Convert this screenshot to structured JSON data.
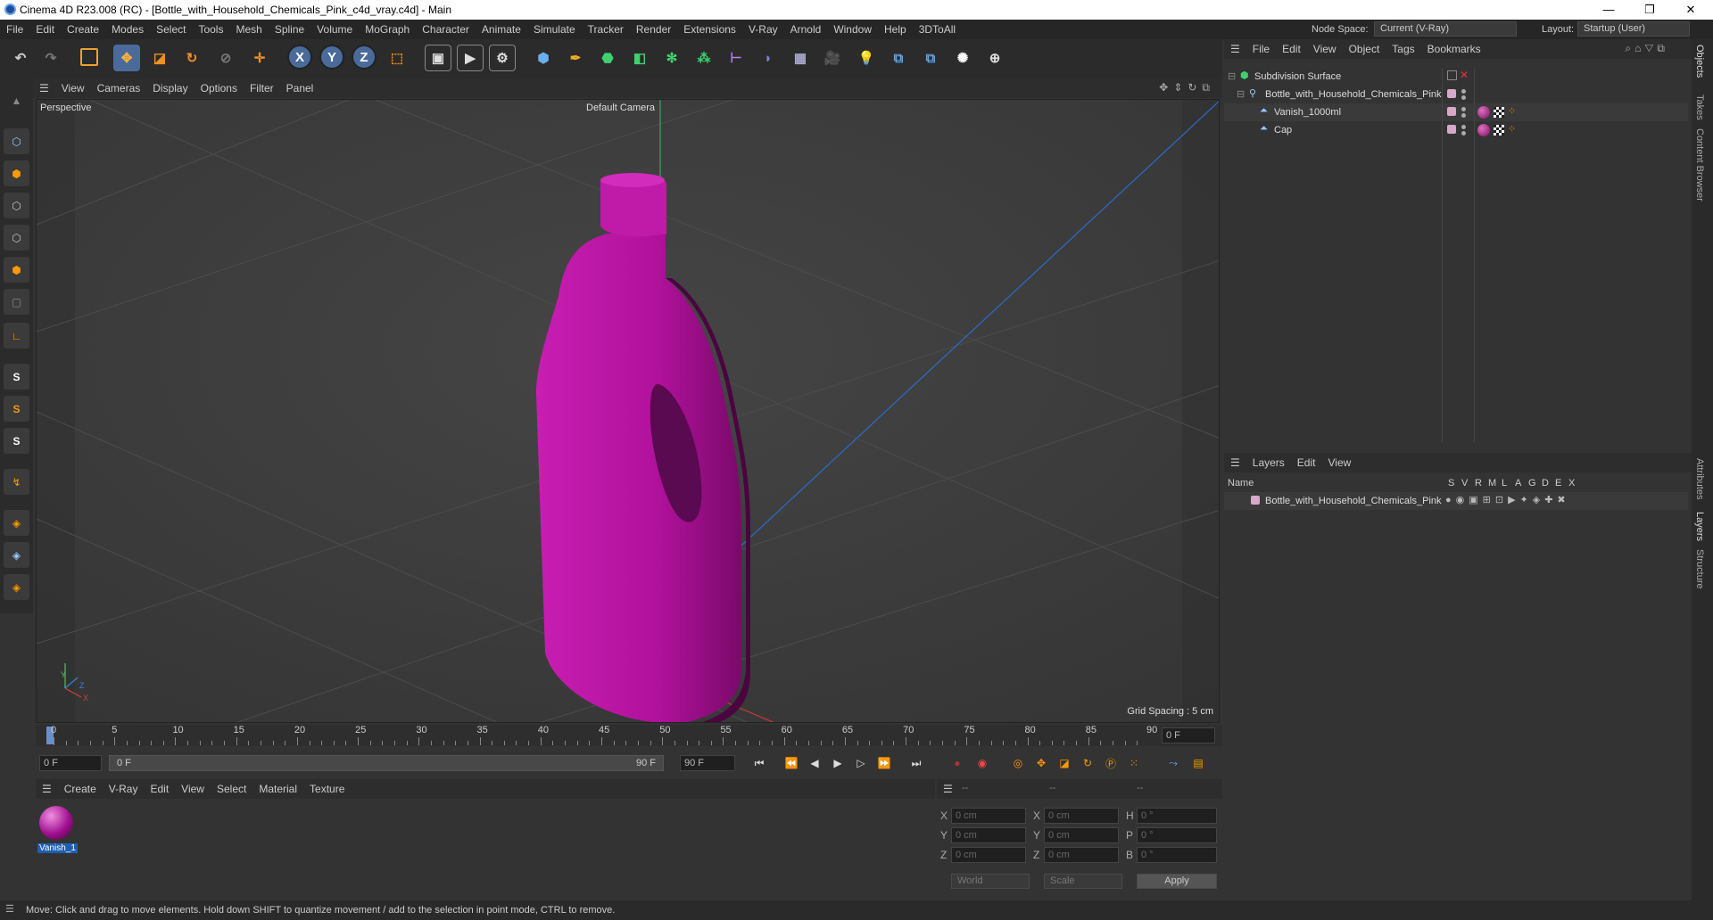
{
  "window": {
    "title": "Cinema 4D R23.008 (RC) - [Bottle_with_Household_Chemicals_Pink_c4d_vray.c4d] - Main",
    "minimize": "—",
    "maximize": "❐",
    "close": "✕"
  },
  "menu": [
    "File",
    "Edit",
    "Create",
    "Modes",
    "Select",
    "Tools",
    "Mesh",
    "Spline",
    "Volume",
    "MoGraph",
    "Character",
    "Animate",
    "Simulate",
    "Tracker",
    "Render",
    "Extensions",
    "V-Ray",
    "Arnold",
    "Window",
    "Help",
    "3DToAll"
  ],
  "nodespace": {
    "label": "Node Space:",
    "value": "Current (V-Ray)"
  },
  "layout": {
    "label": "Layout:",
    "value": "Startup (User)"
  },
  "viewport": {
    "menu": [
      "View",
      "Cameras",
      "Display",
      "Options",
      "Filter",
      "Panel"
    ],
    "label": "Perspective",
    "camera": "Default Camera",
    "grid_spacing": "Grid Spacing : 5 cm",
    "axis_y": "Y",
    "axis_z": "Z",
    "axis_x": "X"
  },
  "timeline": {
    "ticks": [
      "0",
      "5",
      "10",
      "15",
      "20",
      "25",
      "30",
      "35",
      "40",
      "45",
      "50",
      "55",
      "60",
      "65",
      "70",
      "75",
      "80",
      "85",
      "90"
    ],
    "current": "0 F"
  },
  "transport": {
    "start": "0 F",
    "range_start": "0 F",
    "range_end": "90 F",
    "end": "90 F"
  },
  "materials": {
    "menu": [
      "Create",
      "V-Ray",
      "Edit",
      "View",
      "Select",
      "Material",
      "Texture"
    ],
    "items": [
      {
        "name": "Vanish_1"
      }
    ]
  },
  "coords": {
    "headers": [
      "--",
      "--",
      "--"
    ],
    "rows": [
      {
        "a": "X",
        "av": "0 cm",
        "b": "X",
        "bv": "0 cm",
        "c": "H",
        "cv": "0 °"
      },
      {
        "a": "Y",
        "av": "0 cm",
        "b": "Y",
        "bv": "0 cm",
        "c": "P",
        "cv": "0 °"
      },
      {
        "a": "Z",
        "av": "0 cm",
        "b": "Z",
        "bv": "0 cm",
        "c": "B",
        "cv": "0 °"
      }
    ],
    "world": "World",
    "scale": "Scale",
    "apply": "Apply"
  },
  "objects": {
    "menu": [
      "File",
      "Edit",
      "View",
      "Object",
      "Tags",
      "Bookmarks"
    ],
    "tree": [
      {
        "name": "Subdivision Surface",
        "level": 0
      },
      {
        "name": "Bottle_with_Household_Chemicals_Pink",
        "level": 1
      },
      {
        "name": "Vanish_1000ml",
        "level": 2
      },
      {
        "name": "Cap",
        "level": 2
      }
    ]
  },
  "layers": {
    "menu": [
      "Layers",
      "Edit",
      "View"
    ],
    "columns": [
      "Name",
      "S",
      "V",
      "R",
      "M",
      "L",
      "A",
      "G",
      "D",
      "E",
      "X"
    ],
    "rows": [
      {
        "name": "Bottle_with_Household_Chemicals_Pink"
      }
    ]
  },
  "side_tabs": [
    "Objects",
    "Takes",
    "Content Browser",
    "Attributes",
    "Layers",
    "Structure"
  ],
  "status": "Move: Click and drag to move elements. Hold down SHIFT to quantize movement / add to the selection in point mode, CTRL to remove.",
  "colors": {
    "accent": "#1e6fd9",
    "bottle": "#b0119b"
  }
}
